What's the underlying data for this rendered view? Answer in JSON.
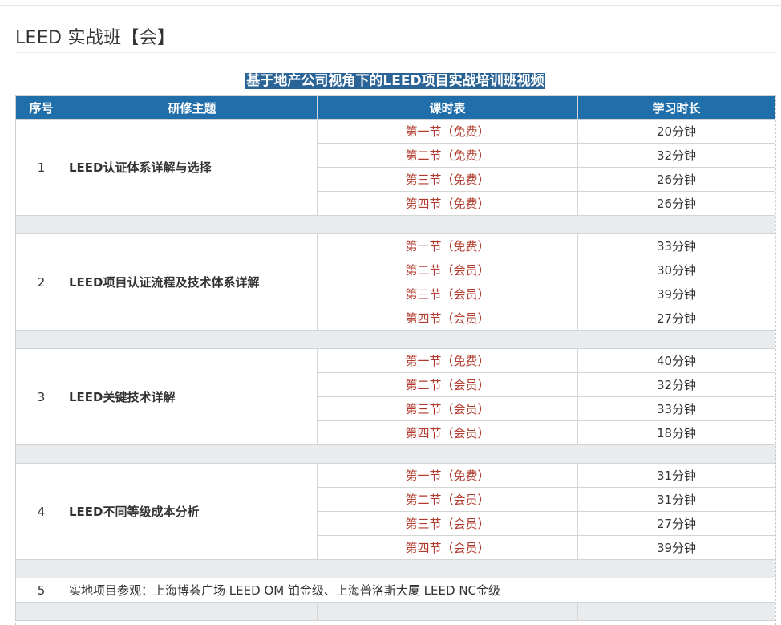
{
  "page": {
    "title": "LEED 实战班【会】"
  },
  "banner": {
    "text": "基于地产公司视角下的LEED项目实战培训班视频"
  },
  "table": {
    "headers": {
      "no": "序号",
      "topic": "研修主题",
      "schedule": "课时表",
      "duration": "学习时长"
    },
    "modules": [
      {
        "no": "1",
        "topic": "LEED认证体系详解与选择",
        "sessions": [
          {
            "label": "第一节（免费）",
            "duration": "20分钟"
          },
          {
            "label": "第二节（免费）",
            "duration": "32分钟"
          },
          {
            "label": "第三节（免费）",
            "duration": "26分钟"
          },
          {
            "label": "第四节（免费）",
            "duration": "26分钟"
          }
        ]
      },
      {
        "no": "2",
        "topic": "LEED项目认证流程及技术体系详解",
        "sessions": [
          {
            "label": "第一节（免费）",
            "duration": "33分钟"
          },
          {
            "label": "第二节（会员）",
            "duration": "30分钟"
          },
          {
            "label": "第三节（会员）",
            "duration": "39分钟"
          },
          {
            "label": "第四节（会员）",
            "duration": "27分钟"
          }
        ]
      },
      {
        "no": "3",
        "topic": "LEED关键技术详解",
        "sessions": [
          {
            "label": "第一节（免费）",
            "duration": "40分钟"
          },
          {
            "label": "第二节（会员）",
            "duration": "32分钟"
          },
          {
            "label": "第三节（会员）",
            "duration": "33分钟"
          },
          {
            "label": "第四节（会员）",
            "duration": "18分钟"
          }
        ]
      },
      {
        "no": "4",
        "topic": "LEED不同等级成本分析",
        "sessions": [
          {
            "label": "第一节（免费）",
            "duration": "31分钟"
          },
          {
            "label": "第二节（会员）",
            "duration": "31分钟"
          },
          {
            "label": "第三节（会员）",
            "duration": "27分钟"
          },
          {
            "label": "第四节（会员）",
            "duration": "39分钟"
          }
        ]
      }
    ],
    "visit": {
      "no": "5",
      "text": "实地项目参观：上海博荟广场 LEED OM 铂金级、上海普洛斯大厦 LEED NC金级"
    }
  },
  "colors": {
    "header_bg": "#206faa",
    "banner_bg": "#2a6496",
    "session_text": "#b13b2e",
    "spacer_bg": "#e9ecee"
  }
}
